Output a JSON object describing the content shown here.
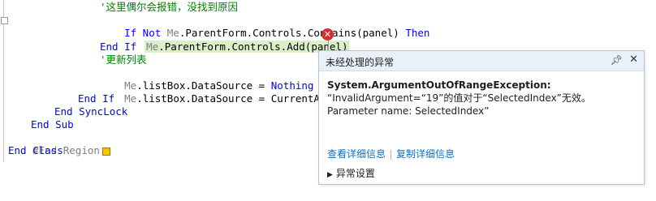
{
  "code": {
    "line1": "'这里偶尔会报错，没找到原因",
    "line2_kw1": "If Not",
    "line2_me": "Me",
    "line2_rest": ".ParentForm.Controls.Contains(panel)",
    "line2_kw2": "Then",
    "line3_me": "Me",
    "line3_rest": ".ParentForm.Controls.Add(panel)",
    "line4": "End If",
    "line5": "'更新列表",
    "line6_me": "Me",
    "line6_rest": ".listBox.DataSource = ",
    "line6_kw": "Nothing",
    "line7_me": "Me",
    "line7_rest": ".listBox.DataSource = CurrentAutoComp",
    "line8": "End If",
    "line9": "End SyncLock",
    "line10": "End Sub",
    "line11": "#End Region",
    "line12": "End Class"
  },
  "exception": {
    "title": "未经处理的异常",
    "pin_icon": "pin-icon",
    "close_icon": "close-icon",
    "type": "System.ArgumentOutOfRangeException:",
    "message": "“InvalidArgument=“19”的值对于“SelectedIndex”无效。",
    "param": "Parameter name: SelectedIndex”",
    "link_details": "查看详细信息",
    "link_copy": "复制详细信息",
    "settings": "异常设置"
  }
}
